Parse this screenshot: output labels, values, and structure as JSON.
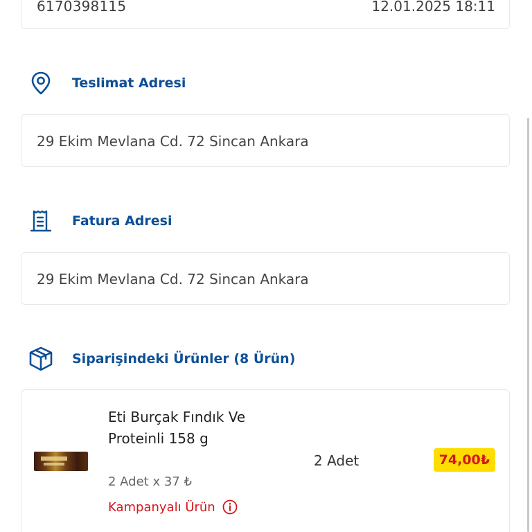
{
  "order": {
    "number": "6170398115",
    "date": "12.01.2025 18:11"
  },
  "delivery": {
    "title": "Teslimat Adresi",
    "icon": "location-pin-icon",
    "address": "29 Ekim Mevlana Cd. 72 Sincan Ankara"
  },
  "billing": {
    "title": "Fatura Adresi",
    "icon": "receipt-icon",
    "address": "29 Ekim Mevlana Cd. 72 Sincan Ankara"
  },
  "products": {
    "title": "Siparişindeki Ürünler (8 Ürün)",
    "icon": "package-icon",
    "items": [
      {
        "name": "Eti Burçak Fındık Ve Proteinli 158 g",
        "quantity": "2 Adet",
        "unit_price": "2 Adet x 37 ₺",
        "price": "74,00₺",
        "campaign_label": "Kampanyalı Ürün"
      }
    ]
  },
  "colors": {
    "brand_blue": "#0d4f96",
    "campaign_red": "#d4161c",
    "price_badge_bg": "#ffdd00"
  }
}
